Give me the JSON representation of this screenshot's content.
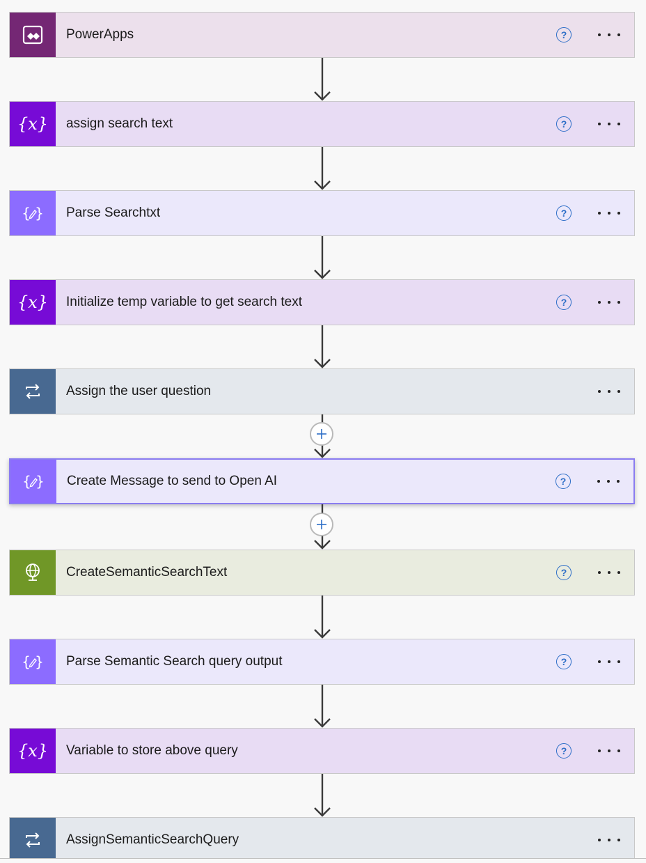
{
  "steps": [
    {
      "title": "PowerApps",
      "icon": "powerapps-icon",
      "icon_bg": "#742774",
      "bg": "#ece0ec",
      "help": true
    },
    {
      "title": "assign search text",
      "icon": "variable-icon",
      "icon_bg": "#770bd6",
      "bg": "#e8dcf4",
      "help": true
    },
    {
      "title": "Parse Searchtxt",
      "icon": "data-operation-icon",
      "icon_bg": "#8c6cff",
      "bg": "#ebe8fb",
      "help": true
    },
    {
      "title": "Initialize temp variable to get search text",
      "icon": "variable-icon",
      "icon_bg": "#770bd6",
      "bg": "#e8dcf4",
      "help": true
    },
    {
      "title": "Assign the user question",
      "icon": "loop-icon",
      "icon_bg": "#486991",
      "bg": "#e4e8ed",
      "help": false
    },
    {
      "title": "Create Message to send to Open AI",
      "icon": "data-operation-icon",
      "icon_bg": "#8c6cff",
      "bg": "#ebe8fb",
      "help": true,
      "selected": true
    },
    {
      "title": "CreateSemanticSearchText",
      "icon": "globe-icon",
      "icon_bg": "#709727",
      "bg": "#e9ecdf",
      "help": true
    },
    {
      "title": "Parse Semantic Search query output",
      "icon": "data-operation-icon",
      "icon_bg": "#8c6cff",
      "bg": "#ebe8fb",
      "help": true
    },
    {
      "title": "Variable to store above query",
      "icon": "variable-icon",
      "icon_bg": "#770bd6",
      "bg": "#e8dcf4",
      "help": true
    },
    {
      "title": "AssignSemanticSearchQuery",
      "icon": "loop-icon",
      "icon_bg": "#486991",
      "bg": "#e4e8ed",
      "help": false
    }
  ],
  "help_label": "?",
  "colors": {
    "arrow": "#3a3a3a",
    "help": "#2d6ec7",
    "add": "#2d6ec7",
    "selected_border": "#8a7cf0"
  }
}
